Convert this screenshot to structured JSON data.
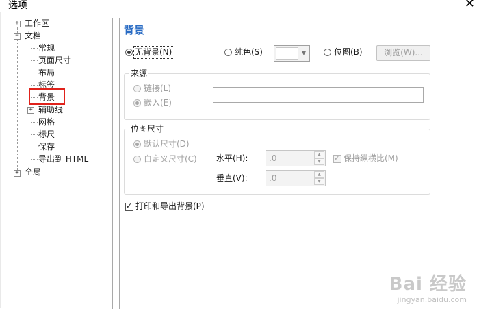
{
  "window": {
    "title": "选项",
    "close_glyph": "✕"
  },
  "tree": {
    "items": [
      {
        "label": "工作区",
        "expander": "+"
      },
      {
        "label": "文档",
        "expander": "−"
      },
      {
        "label": "常规"
      },
      {
        "label": "页面尺寸"
      },
      {
        "label": "布局"
      },
      {
        "label": "标签"
      },
      {
        "label": "背景",
        "selected": true
      },
      {
        "label": "辅助线",
        "expander": "+"
      },
      {
        "label": "网格"
      },
      {
        "label": "标尺"
      },
      {
        "label": "保存"
      },
      {
        "label": "导出到 HTML"
      },
      {
        "label": "全局",
        "expander": "+"
      }
    ]
  },
  "panel": {
    "title": "背景",
    "bg_type": {
      "none_label": "无背景(N)",
      "solid_label": "纯色(S)",
      "bitmap_label": "位图(B)",
      "browse_label": "浏览(W)...",
      "selected": "none"
    },
    "source": {
      "legend": "来源",
      "link_label": "链接(L)",
      "embed_label": "嵌入(E)",
      "path_value": ""
    },
    "bitmap_size": {
      "legend": "位图尺寸",
      "default_label": "默认尺寸(D)",
      "custom_label": "自定义尺寸(C)",
      "horizontal_label": "水平(H):",
      "horizontal_value": ".0",
      "vertical_label": "垂直(V):",
      "vertical_value": ".0",
      "keep_ratio_label": "保持纵横比(M)",
      "keep_ratio_checked": true
    },
    "print_export_label": "打印和导出背景(P)",
    "print_export_checked": true
  },
  "watermark": {
    "brand": "Bai 经验",
    "url": "jingyan.baidu.com"
  },
  "colors": {
    "accent": "#2a6cc4",
    "highlight": "#e0221b"
  }
}
